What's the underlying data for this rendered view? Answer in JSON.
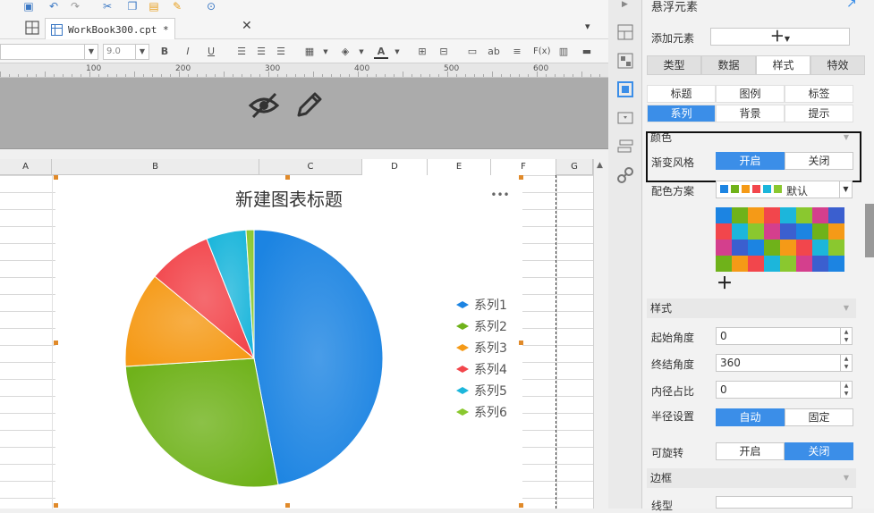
{
  "tab": {
    "filename": "WorkBook300.cpt *"
  },
  "format_bar": {
    "font_size": "9.0",
    "bold": "B",
    "italic": "I",
    "underline": "U",
    "text_color_letter": "A",
    "ab_label": "ab",
    "fx_label": "F(x)"
  },
  "ruler": {
    "ticks": [
      "100",
      "200",
      "300",
      "400",
      "500",
      "600"
    ]
  },
  "columns": [
    "A",
    "B",
    "C",
    "D",
    "E",
    "F",
    "G"
  ],
  "chart": {
    "more_icon": "•••"
  },
  "chart_data": {
    "type": "pie",
    "title": "新建图表标题",
    "series": [
      {
        "name": "系列1",
        "value": 47,
        "color": "#1c84e2"
      },
      {
        "name": "系列2",
        "value": 27,
        "color": "#6fb21a"
      },
      {
        "name": "系列3",
        "value": 12,
        "color": "#f59a17"
      },
      {
        "name": "系列4",
        "value": 8,
        "color": "#f2464c"
      },
      {
        "name": "系列5",
        "value": 5,
        "color": "#1cb6db"
      },
      {
        "name": "系列6",
        "value": 1,
        "color": "#8ac82f"
      }
    ],
    "legend_position": "right"
  },
  "panel": {
    "header": "悬浮元素",
    "add_element_label": "添加元素",
    "main_tabs": [
      "类型",
      "数据",
      "样式",
      "特效"
    ],
    "sub_tabs": [
      "标题",
      "图例",
      "标签",
      "系列",
      "背景",
      "提示"
    ],
    "color_section": "颜色",
    "gradient_label": "渐变风格",
    "gradient_on": "开启",
    "gradient_off": "关闭",
    "scheme_label": "配色方案",
    "scheme_value": "默认",
    "style_section": "样式",
    "start_angle_label": "起始角度",
    "start_angle": "0",
    "end_angle_label": "终结角度",
    "end_angle": "360",
    "inner_ratio_label": "内径占比",
    "inner_ratio": "0",
    "radius_label": "半径设置",
    "radius_auto": "自动",
    "radius_fixed": "固定",
    "rotatable_label": "可旋转",
    "rotatable_on": "开启",
    "rotatable_off": "关闭",
    "border_section": "边框",
    "line_type_label": "线型"
  },
  "palette": [
    "#1c84e2",
    "#6fb21a",
    "#f59a17",
    "#f2464c",
    "#1cb6db",
    "#8ac82f",
    "#d43f8d",
    "#3b5fcf"
  ]
}
